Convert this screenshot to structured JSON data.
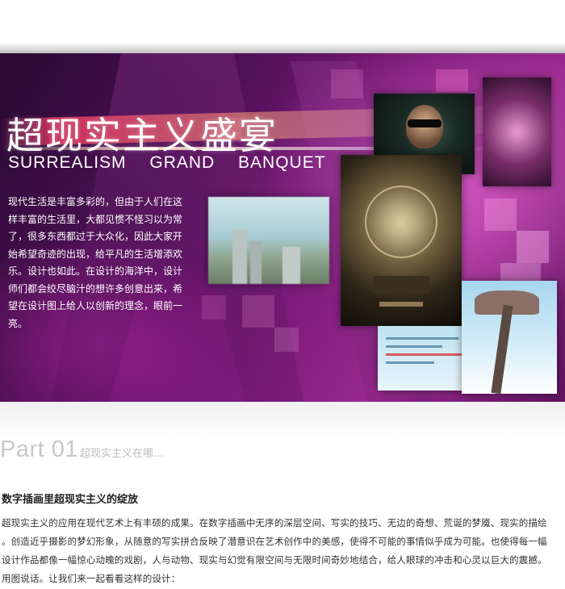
{
  "hero": {
    "title": "超现实主义盛宴",
    "subtitle": "SURREALISM GRAND BANQUET",
    "body_lines": [
      "现代生活是丰富多彩的，但由于人们在这",
      "样丰富的生活里，大都见惯不怪习以为常",
      "了，很多东西都过于大众化，因此大家开",
      "始希望奇迹的出现，给平凡的生活增添欢",
      "乐。设计也如此。在设计的海洋中，设计",
      "师们都会绞尽脑汁的想许多创意出来，希",
      "望在设计图上给人以创新的理念，眼前一",
      "亮。"
    ],
    "colors": {
      "background_primary": "#4b0f55",
      "accent_magenta": "#9a2a8e",
      "streak": "#ff3c64"
    }
  },
  "section": {
    "part_label": "Part 01",
    "part_subtitle": "超现实主义在哪...",
    "title": "数字插画里超现实主义的绽放",
    "body_lines": [
      "超现实主义的应用在现代艺术上有丰硕的成果。在数字插画中无序的深层空间、写实的技巧、无边的奇想、荒诞的梦魇、现实的描绘",
      "。创造近乎摄影的梦幻形象，从随意的写实拼合反映了潜意识在艺术创作中的美感，使得不可能的事情似乎成为可能。也使得每一幅",
      "设计作品都像一幅惊心动魄的戏剧，人与动物、现实与幻觉有限空间与无限时间奇妙地结合，给人眼球的冲击和心灵以巨大的震撼。",
      "用图说话。让我们来一起看看这样的设计："
    ]
  }
}
